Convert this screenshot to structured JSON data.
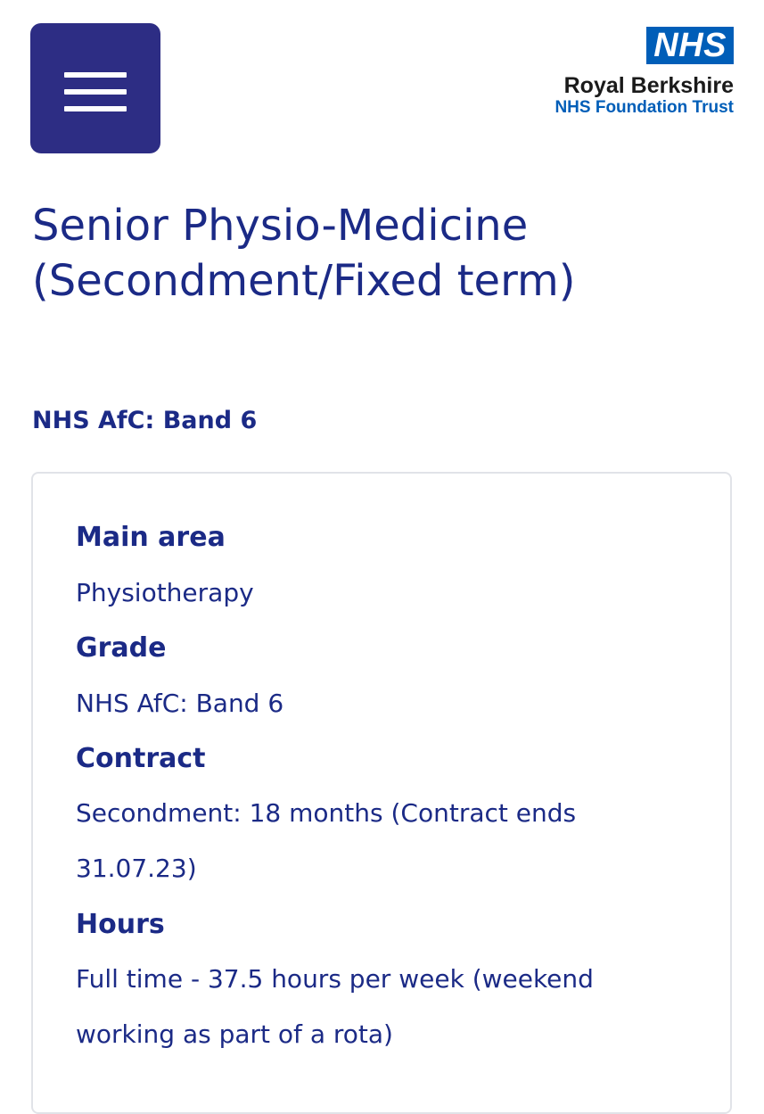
{
  "header": {
    "logo": {
      "nhs_mark": "NHS",
      "org_name": "Royal Berkshire",
      "org_subtitle": "NHS Foundation Trust"
    }
  },
  "job": {
    "title": "Senior Physio-Medicine (Secondment/Fixed term)",
    "band": "NHS AfC: Band 6"
  },
  "details": {
    "main_area_label": "Main area",
    "main_area_value": "Physiotherapy",
    "grade_label": "Grade",
    "grade_value": "NHS AfC: Band 6",
    "contract_label": "Contract",
    "contract_value": "Secondment: 18 months (Contract ends 31.07.23)",
    "hours_label": "Hours",
    "hours_value": "Full time - 37.5 hours per week (weekend working as part of a rota)"
  },
  "colors": {
    "menu_button": "#2d2d84",
    "nhs_blue": "#005eb8",
    "heading_text": "#1b2a86",
    "card_border": "#e1e3e8"
  }
}
